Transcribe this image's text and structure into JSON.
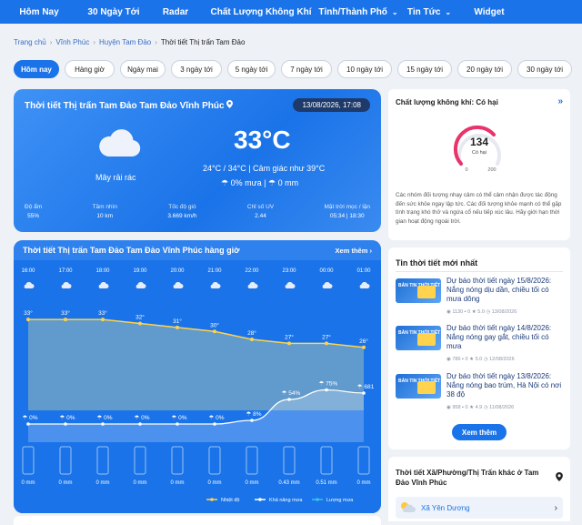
{
  "nav": [
    "Hôm Nay",
    "30 Ngày Tới",
    "Radar",
    "Chất Lượng Không Khí",
    "Tỉnh/Thành Phố",
    "Tin Tức",
    "Widget"
  ],
  "breadcrumb": [
    "Trang chủ",
    "Vĩnh Phúc",
    "Huyện Tam Đảo",
    "Thời tiết Thị trấn Tam Đảo"
  ],
  "tabs": [
    "Hôm nay",
    "Hàng giờ",
    "Ngày mai",
    "3 ngày tới",
    "5 ngày tới",
    "7 ngày tới",
    "10 ngày tới",
    "15 ngày tới",
    "20 ngày tới",
    "30 ngày tới"
  ],
  "current": {
    "title": "Thời tiết Thị trấn Tam Đảo Tam Đảo Vĩnh Phúc",
    "date": "13/08/2026, 17:08",
    "sky": "Mây rải rác",
    "temp": "33°C",
    "range": "24°C / 34°C | Cảm giác như 39°C",
    "rain_pct": "0% mưa",
    "rain_mm": "0 mm",
    "stats": [
      {
        "label": "Độ ẩm",
        "value": "55%"
      },
      {
        "label": "Tầm nhìn",
        "value": "10 km"
      },
      {
        "label": "Tốc độ gió",
        "value": "3.669 km/h"
      },
      {
        "label": "Chỉ số UV",
        "value": "2.44"
      },
      {
        "label": "Mặt trời mọc / lặn",
        "value": "05:34 | 18:30"
      }
    ]
  },
  "hourly": {
    "title": "Thời tiết Thị trấn Tam Đảo Tam Đảo Vĩnh Phúc hàng giờ",
    "more": "Xem thêm",
    "times": [
      "16:00",
      "17:00",
      "18:00",
      "19:00",
      "20:00",
      "21:00",
      "22:00",
      "23:00",
      "00:00",
      "01:00"
    ],
    "temps": [
      "33°",
      "33°",
      "33°",
      "32°",
      "31°",
      "30°",
      "28°",
      "27°",
      "27°",
      "26°"
    ],
    "temp_values": [
      33,
      33,
      33,
      32,
      31,
      30,
      28,
      27,
      27,
      26
    ],
    "rain_labels": [
      "0%",
      "0%",
      "0%",
      "0%",
      "0%",
      "0%",
      "8%",
      "54%",
      "75%",
      "681"
    ],
    "rain_values": [
      0,
      0,
      0,
      0,
      0,
      0,
      8,
      54,
      75,
      68
    ],
    "mm": [
      "0 mm",
      "0 mm",
      "0 mm",
      "0 mm",
      "0 mm",
      "0 mm",
      "0 mm",
      "0.43 mm",
      "0.51 mm",
      "0 mm"
    ],
    "legend": [
      "Nhiệt độ",
      "Khả năng mưa",
      "Lượng mưa"
    ],
    "legend_colors": [
      "#ffd34d",
      "#ffffff",
      "#37c3f0"
    ]
  },
  "air": {
    "title": "Chất lượng không khí: Có hại",
    "aqi": "134",
    "aqi_label": "Có hại",
    "min": "0",
    "max": "200",
    "aqi_color": "#e8346b",
    "description": "Các nhóm đối tượng nhạy cảm có thể cảm nhận được tác động đến sức khỏe ngay lập tức. Các đối tượng khỏe mạnh có thể gặp tình trạng khó thở và ngứa cổ nếu tiếp xúc lâu. Hãy giới hạn thời gian hoạt động ngoài trời."
  },
  "news": {
    "title": "Tin thời tiết mới nhất",
    "thumb_text": "BẢN TIN THỜI TIẾT",
    "items": [
      {
        "title": "Dự báo thời tiết ngày 15/8/2026: Nắng nóng dịu dần, chiều tối có mưa dông",
        "views": "1130",
        "comments": "0",
        "rating": "5.0",
        "date": "13/08/2026"
      },
      {
        "title": "Dự báo thời tiết ngày 14/8/2026: Nắng nóng gay gắt, chiều tối có mưa",
        "views": "786",
        "comments": "0",
        "rating": "5.0",
        "date": "12/08/2026"
      },
      {
        "title": "Dự báo thời tiết ngày 13/8/2026: Nắng nóng bao trùm, Hà Nội có nơi 38 độ",
        "views": "958",
        "comments": "0",
        "rating": "4.9",
        "date": "11/08/2026"
      }
    ],
    "more": "Xem thêm"
  },
  "other": {
    "title": "Thời tiết Xã/Phường/Thị Trấn khác ở Tam Đảo Vĩnh Phúc",
    "item": "Xã Yên Dương"
  }
}
